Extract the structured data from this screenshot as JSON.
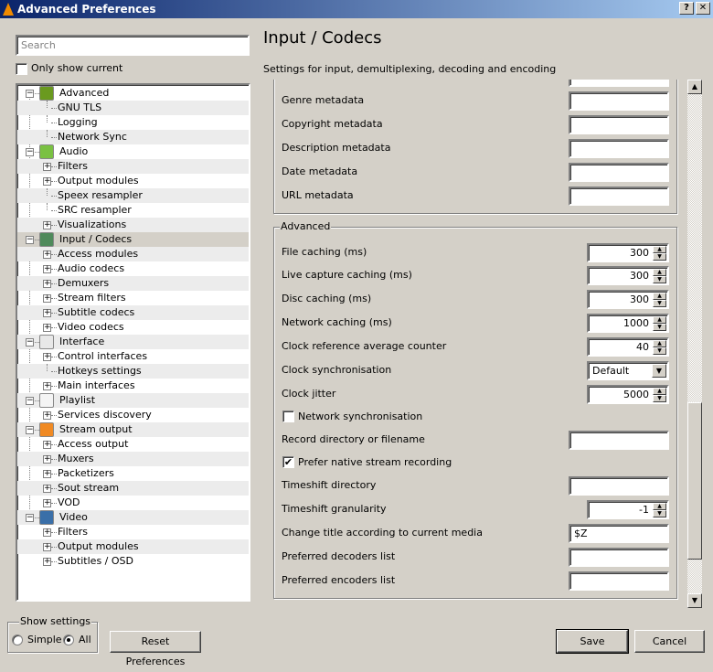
{
  "window": {
    "title": "Advanced Preferences",
    "help_label": "?",
    "close_label": "✕"
  },
  "search": {
    "placeholder": "Search",
    "value": ""
  },
  "only_show_current": {
    "label": "Only show current",
    "checked": false
  },
  "tree": [
    {
      "label": "Advanced",
      "level": 0,
      "expander": "minus",
      "icon": "cpu-icon",
      "color": "#6a9a1f"
    },
    {
      "label": "GNU TLS",
      "level": 1,
      "expander": "none"
    },
    {
      "label": "Logging",
      "level": 1,
      "expander": "none"
    },
    {
      "label": "Network Sync",
      "level": 1,
      "expander": "none"
    },
    {
      "label": "Audio",
      "level": 0,
      "expander": "minus",
      "icon": "music-note-icon",
      "color": "#7ac142"
    },
    {
      "label": "Filters",
      "level": 1,
      "expander": "plus"
    },
    {
      "label": "Output modules",
      "level": 1,
      "expander": "plus"
    },
    {
      "label": "Speex resampler",
      "level": 1,
      "expander": "none"
    },
    {
      "label": "SRC resampler",
      "level": 1,
      "expander": "none"
    },
    {
      "label": "Visualizations",
      "level": 1,
      "expander": "plus"
    },
    {
      "label": "Input / Codecs",
      "level": 0,
      "expander": "minus",
      "icon": "codec-icon",
      "color": "#4f8a5b",
      "selected": true
    },
    {
      "label": "Access modules",
      "level": 1,
      "expander": "plus"
    },
    {
      "label": "Audio codecs",
      "level": 1,
      "expander": "plus"
    },
    {
      "label": "Demuxers",
      "level": 1,
      "expander": "plus"
    },
    {
      "label": "Stream filters",
      "level": 1,
      "expander": "plus"
    },
    {
      "label": "Subtitle codecs",
      "level": 1,
      "expander": "plus"
    },
    {
      "label": "Video codecs",
      "level": 1,
      "expander": "plus"
    },
    {
      "label": "Interface",
      "level": 0,
      "expander": "minus",
      "icon": "interface-icon",
      "color": "#e8e8e8"
    },
    {
      "label": "Control interfaces",
      "level": 1,
      "expander": "plus"
    },
    {
      "label": "Hotkeys settings",
      "level": 1,
      "expander": "none"
    },
    {
      "label": "Main interfaces",
      "level": 1,
      "expander": "plus"
    },
    {
      "label": "Playlist",
      "level": 0,
      "expander": "minus",
      "icon": "playlist-icon",
      "color": "#f4f4f4"
    },
    {
      "label": "Services discovery",
      "level": 1,
      "expander": "plus"
    },
    {
      "label": "Stream output",
      "level": 0,
      "expander": "minus",
      "icon": "stream-output-icon",
      "color": "#f08a24"
    },
    {
      "label": "Access output",
      "level": 1,
      "expander": "plus"
    },
    {
      "label": "Muxers",
      "level": 1,
      "expander": "plus"
    },
    {
      "label": "Packetizers",
      "level": 1,
      "expander": "plus"
    },
    {
      "label": "Sout stream",
      "level": 1,
      "expander": "plus"
    },
    {
      "label": "VOD",
      "level": 1,
      "expander": "plus"
    },
    {
      "label": "Video",
      "level": 0,
      "expander": "minus",
      "icon": "film-icon",
      "color": "#3a6fa8"
    },
    {
      "label": "Filters",
      "level": 1,
      "expander": "plus"
    },
    {
      "label": "Output modules",
      "level": 1,
      "expander": "plus"
    },
    {
      "label": "Subtitles / OSD",
      "level": 1,
      "expander": "plus"
    }
  ],
  "panel": {
    "title": "Input / Codecs",
    "subtitle": "Settings for input, demultiplexing, decoding and encoding"
  },
  "metadata_rows": [
    {
      "label": "Genre metadata",
      "value": ""
    },
    {
      "label": "Copyright metadata",
      "value": ""
    },
    {
      "label": "Description metadata",
      "value": ""
    },
    {
      "label": "Date metadata",
      "value": ""
    },
    {
      "label": "URL metadata",
      "value": ""
    }
  ],
  "advanced": {
    "title": "Advanced",
    "rows": [
      {
        "label": "File caching (ms)",
        "type": "spin",
        "value": "300"
      },
      {
        "label": "Live capture caching (ms)",
        "type": "spin",
        "value": "300"
      },
      {
        "label": "Disc caching (ms)",
        "type": "spin",
        "value": "300"
      },
      {
        "label": "Network caching (ms)",
        "type": "spin",
        "value": "1000"
      },
      {
        "label": "Clock reference average counter",
        "type": "spin",
        "value": "40"
      },
      {
        "label": "Clock synchronisation",
        "type": "combo",
        "value": "Default"
      },
      {
        "label": "Clock jitter",
        "type": "spin",
        "value": "5000"
      },
      {
        "label": "Network synchronisation",
        "type": "check",
        "checked": false
      },
      {
        "label": "Record directory or filename",
        "type": "text",
        "value": ""
      },
      {
        "label": "Prefer native stream recording",
        "type": "check",
        "checked": true
      },
      {
        "label": "Timeshift directory",
        "type": "text",
        "value": ""
      },
      {
        "label": "Timeshift granularity",
        "type": "spin",
        "value": "-1"
      },
      {
        "label": "Change title according to current media",
        "type": "text",
        "value": "$Z"
      },
      {
        "label": "Preferred decoders list",
        "type": "text",
        "value": ""
      },
      {
        "label": "Preferred encoders list",
        "type": "text",
        "value": ""
      }
    ]
  },
  "scroll_position": 0.9,
  "footer": {
    "show_settings_label": "Show settings",
    "simple_label": "Simple",
    "all_label": "All",
    "selected": "All",
    "reset_label": "Reset Preferences",
    "save_label": "Save",
    "cancel_label": "Cancel"
  }
}
